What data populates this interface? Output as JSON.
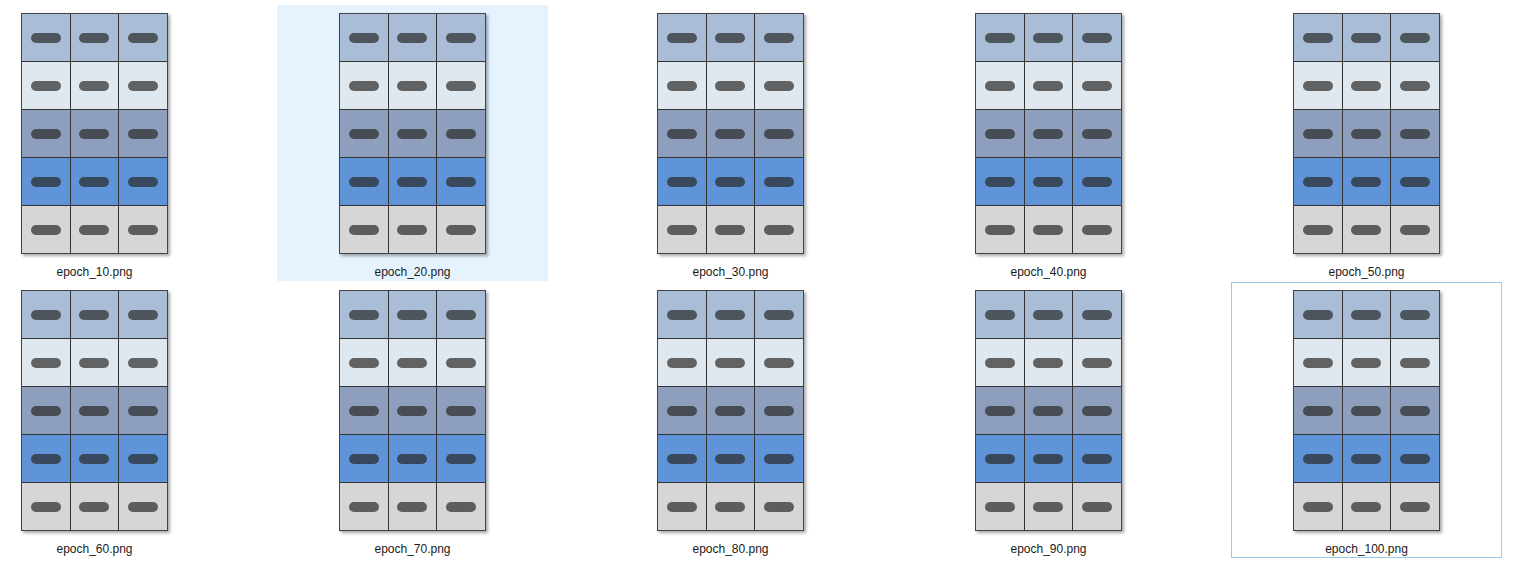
{
  "files": [
    {
      "name": "epoch_10.png",
      "selected": false,
      "focused": false
    },
    {
      "name": "epoch_20.png",
      "selected": true,
      "focused": false
    },
    {
      "name": "epoch_30.png",
      "selected": false,
      "focused": false
    },
    {
      "name": "epoch_40.png",
      "selected": false,
      "focused": false
    },
    {
      "name": "epoch_50.png",
      "selected": false,
      "focused": false
    },
    {
      "name": "epoch_60.png",
      "selected": false,
      "focused": false
    },
    {
      "name": "epoch_70.png",
      "selected": false,
      "focused": false
    },
    {
      "name": "epoch_80.png",
      "selected": false,
      "focused": false
    },
    {
      "name": "epoch_90.png",
      "selected": false,
      "focused": false
    },
    {
      "name": "epoch_100.png",
      "selected": false,
      "focused": true
    }
  ]
}
